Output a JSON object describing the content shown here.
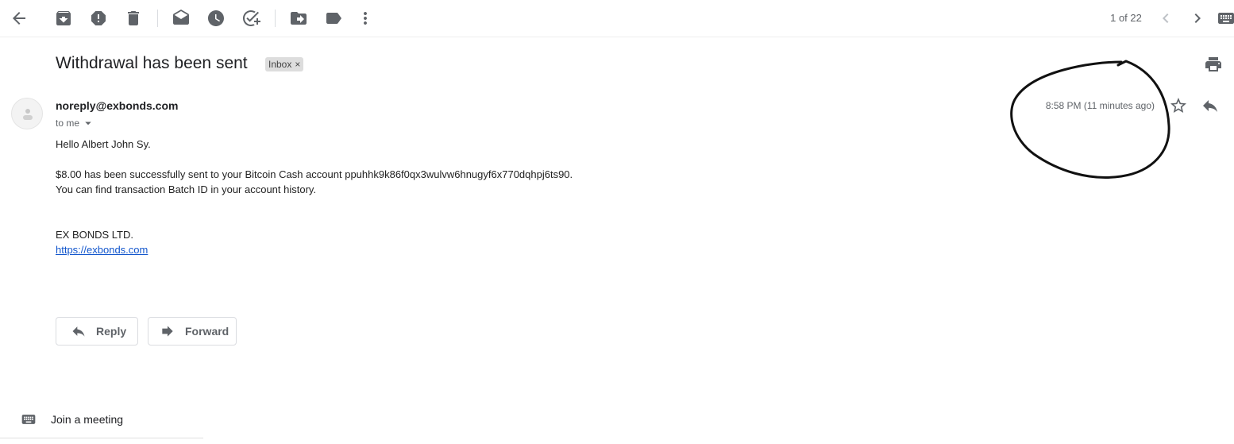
{
  "toolbar": {
    "pager_text": "1 of 22",
    "icons": [
      "arrow-back-icon",
      "archive-icon",
      "report-spam-icon",
      "delete-icon",
      "mark-unread-icon",
      "snooze-icon",
      "add-task-icon",
      "move-to-icon",
      "label-icon",
      "more-vert-icon",
      "newer-icon",
      "older-icon",
      "keyboard-icon"
    ]
  },
  "message": {
    "subject": "Withdrawal has been sent",
    "label": "Inbox",
    "label_remove": "×",
    "sender": "noreply@exbonds.com",
    "recipient_text": "to me",
    "timestamp": "8:58 PM (11 minutes ago)",
    "body": {
      "greeting": "Hello Albert John Sy.",
      "line1": "$8.00 has been successfully sent to your Bitcoin Cash account ppuhhk9k86f0qx3wulvw6hnugyf6x770dqhpj6ts90.",
      "line2": "You can find transaction Batch ID in your account history.",
      "company": "EX BONDS LTD.",
      "link": "https://exbonds.com"
    }
  },
  "actions": {
    "reply_label": "Reply",
    "forward_label": "Forward"
  },
  "footer": {
    "meet_label": "Join a meeting"
  },
  "colors": {
    "link": "#1155cc",
    "icon": "#5f6368",
    "annotation": "#111111"
  }
}
